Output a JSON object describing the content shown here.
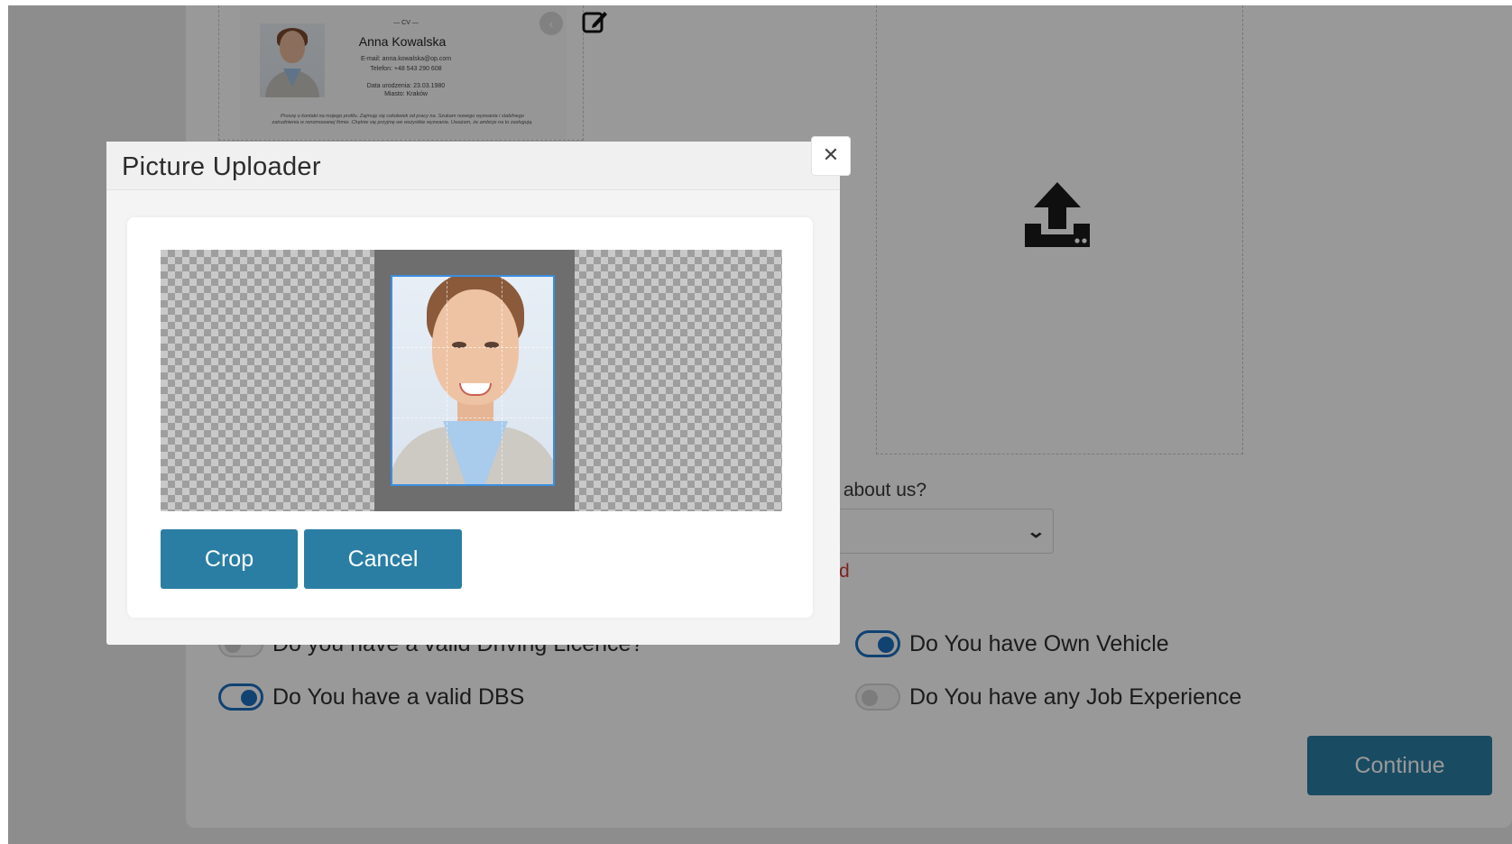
{
  "cv_preview": {
    "heading": "— CV —",
    "name": "Anna Kowalska",
    "email_line": "E-mail: anna.kowalska@op.com",
    "phone_line": "Telefon: +48 543 290 608",
    "birth_line": "Data urodzenia: 23.03.1980",
    "city_line": "Miasto: Kraków",
    "summary": "Proszę o kontakt na mojego profilu. Zajmuję się cokolwiek od pracy na. Szukam nowego wyzwania i stabilnego zatrudnienia w renomowanej firmie. Chętnie się przyjmę we wszystkie wyzwania. Uważam, że ambicje na to zasługują."
  },
  "form": {
    "question_label": "r about us?",
    "select_chevron": "⌄",
    "error_text": "d",
    "toggles": [
      {
        "label": "Do you have a valid Driving Licence?",
        "state": "off"
      },
      {
        "label": "Do You have Own Vehicle",
        "state": "on"
      },
      {
        "label": "Do You have a valid DBS",
        "state": "on"
      },
      {
        "label": "Do You have any Job Experience",
        "state": "off"
      }
    ],
    "continue_label": "Continue"
  },
  "modal": {
    "title": "Picture Uploader",
    "close_symbol": "✕",
    "crop_label": "Crop",
    "cancel_label": "Cancel"
  },
  "icons": {
    "nav": "chevron-left-icon",
    "edit": "edit-icon",
    "upload": "upload-icon",
    "close": "close-icon"
  },
  "colors": {
    "primary_button": "#2a7ea4",
    "toggle_on": "#1b6fbe",
    "error": "#d63a3a"
  }
}
